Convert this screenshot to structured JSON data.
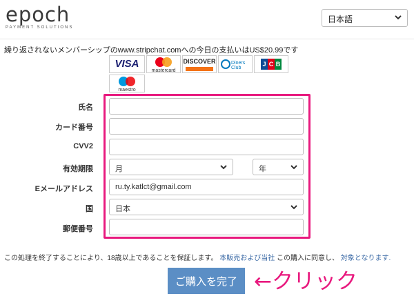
{
  "brand": {
    "name": "epoch",
    "tagline": "PAYMENT SOLUTIONS"
  },
  "language": {
    "selected": "日本語"
  },
  "summary": "繰り返されないメンバーシップのwww.stripchat.comへの今日の支払いはUS$20.99です",
  "cards": [
    "VISA",
    "mastercard",
    "DISCOVER",
    "Diners Club",
    "JCB",
    "maestro"
  ],
  "form": {
    "name_label": "氏名",
    "card_label": "カード番号",
    "cvv_label": "CVV2",
    "expiry_label": "有効期限",
    "month_value": "月",
    "year_value": "年",
    "email_label": "Eメールアドレス",
    "email_value": "ru.ty.katlct@gmail.com",
    "country_label": "国",
    "country_value": "日本",
    "postal_label": "郵便番号"
  },
  "terms": {
    "part1": "この処理を終了することにより、18歳以上であることを保証します。",
    "link1": "本販売および当社",
    "part2": "この購入に同意し、",
    "link2": "対象となります."
  },
  "submit_label": "ご購入を完了",
  "annotation": "←クリック"
}
